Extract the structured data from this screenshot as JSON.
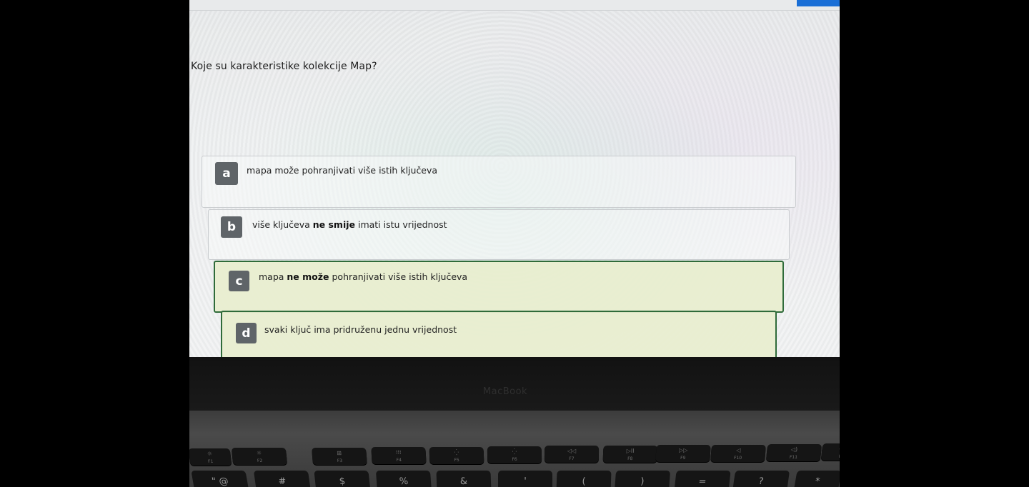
{
  "quiz": {
    "question": "Koje su karakteristike kolekcije Map?",
    "options": [
      {
        "letter": "a",
        "text_pre": "mapa može pohranjivati više istih ključeva",
        "bold": "",
        "text_post": "",
        "selected": false
      },
      {
        "letter": "b",
        "text_pre": "više ključeva ",
        "bold": "ne smije",
        "text_post": " imati istu vrijednost",
        "selected": false
      },
      {
        "letter": "c",
        "text_pre": "mapa ",
        "bold": "ne može",
        "text_post": " pohranjivati više istih ključeva",
        "selected": true
      },
      {
        "letter": "d",
        "text_pre": "svaki ključ ima pridruženu jednu vrijednost",
        "bold": "",
        "text_post": "",
        "selected": true
      }
    ]
  },
  "laptop": {
    "brand": "MacBook",
    "fkeys": [
      {
        "label": "☼",
        "fn": "F1"
      },
      {
        "label": "☼",
        "fn": "F2"
      },
      {
        "label": "⊞",
        "fn": "F3"
      },
      {
        "label": "⁞⁞⁞",
        "fn": "F4"
      },
      {
        "label": "⁛",
        "fn": "F5"
      },
      {
        "label": "⁛",
        "fn": "F6"
      },
      {
        "label": "◁◁",
        "fn": "F7"
      },
      {
        "label": "▷II",
        "fn": "F8"
      },
      {
        "label": "▷▷",
        "fn": "F9"
      },
      {
        "label": "◁",
        "fn": "F10"
      },
      {
        "label": "◁)",
        "fn": "F11"
      },
      {
        "label": "◁))",
        "fn": "F12"
      }
    ],
    "numkeys": [
      "\" @",
      "#",
      "$",
      "%",
      "&",
      "'",
      "(",
      ")",
      "=",
      "?",
      "*"
    ]
  },
  "colors": {
    "selected_border": "#2f6b3a",
    "selected_bg": "#e8eece",
    "letter_badge": "#5f6468",
    "top_button": "#1a6fd6"
  }
}
